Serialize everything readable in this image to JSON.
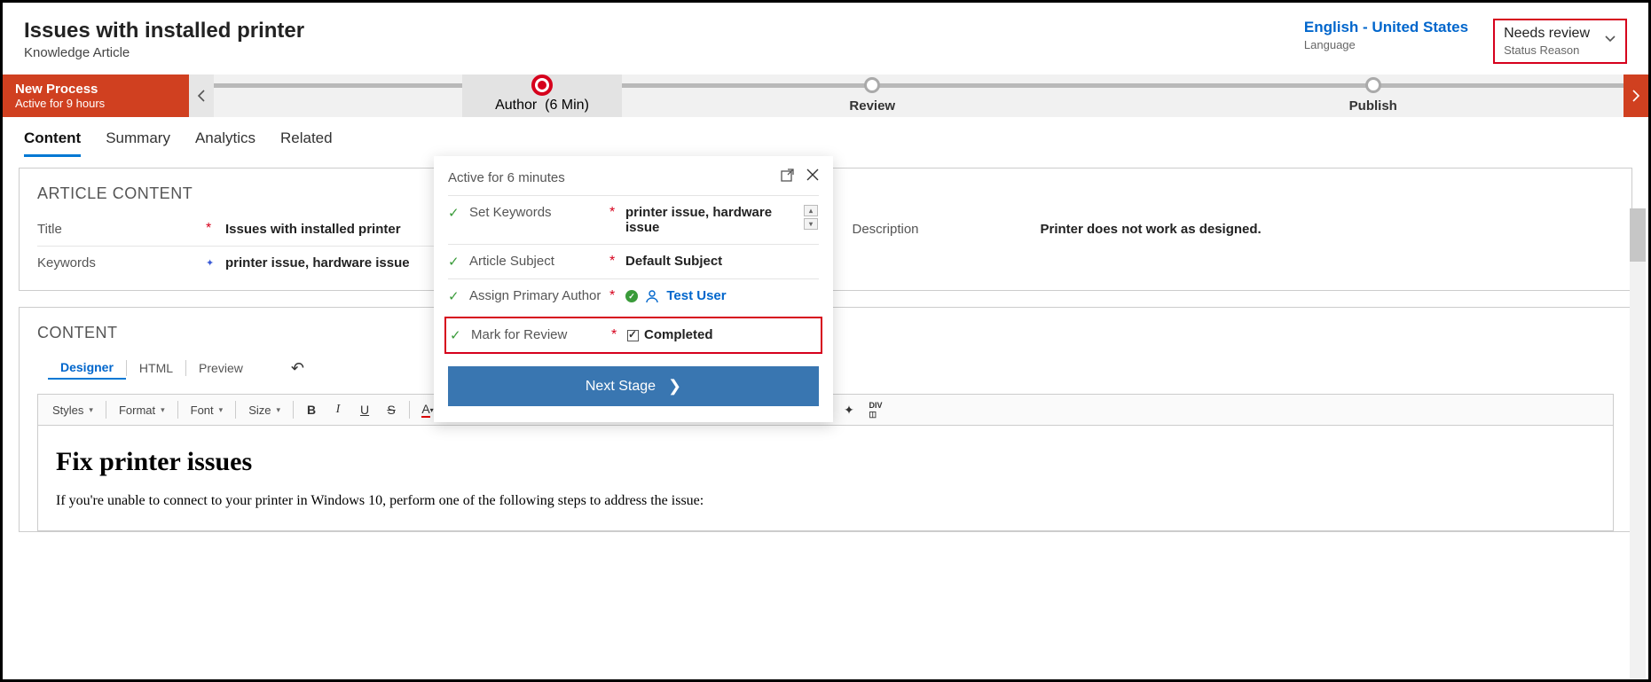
{
  "header": {
    "title": "Issues with installed printer",
    "subtitle": "Knowledge Article",
    "language_value": "English - United States",
    "language_label": "Language",
    "status_value": "Needs review",
    "status_label": "Status Reason"
  },
  "process": {
    "name": "New Process",
    "active": "Active for 9 hours",
    "stages": {
      "author": "Author",
      "author_time": "(6 Min)",
      "review": "Review",
      "publish": "Publish"
    }
  },
  "tabs": [
    "Content",
    "Summary",
    "Analytics",
    "Related"
  ],
  "article": {
    "section": "ARTICLE CONTENT",
    "title_label": "Title",
    "title_value": "Issues with installed printer",
    "keywords_label": "Keywords",
    "keywords_value": "printer issue, hardware issue",
    "description_label": "Description",
    "description_value": "Printer does not work as designed."
  },
  "editor": {
    "section": "CONTENT",
    "tabs": {
      "designer": "Designer",
      "html": "HTML",
      "preview": "Preview"
    },
    "dropdowns": {
      "styles": "Styles",
      "format": "Format",
      "font": "Font",
      "size": "Size"
    },
    "body_h1": "Fix printer issues",
    "body_p": "If you're unable to connect to your printer in Windows 10, perform one of the following steps to address the issue:"
  },
  "flyout": {
    "title": "Active for 6 minutes",
    "rows": {
      "keywords_label": "Set Keywords",
      "keywords_value": "printer issue, hardware issue",
      "subject_label": "Article Subject",
      "subject_value": "Default Subject",
      "author_label": "Assign Primary Author",
      "author_value": "Test User",
      "mark_label": "Mark for Review",
      "mark_value": "Completed"
    },
    "next": "Next Stage"
  }
}
